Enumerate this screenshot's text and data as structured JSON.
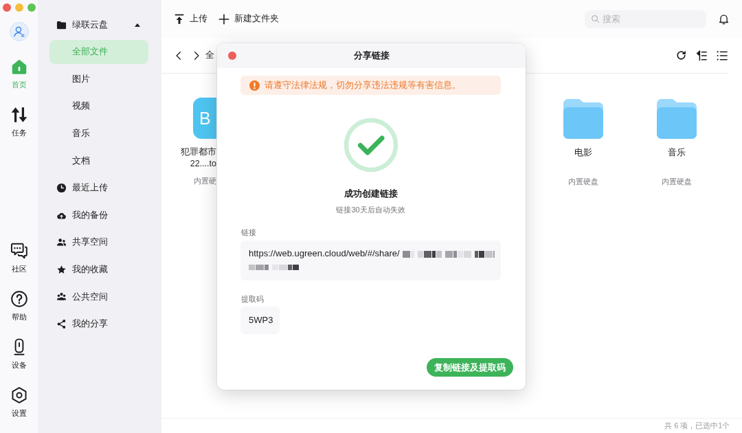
{
  "rail": {
    "top": [
      {
        "label": "首页",
        "selected": true
      },
      {
        "label": "任务",
        "selected": false
      }
    ],
    "bottom": [
      {
        "label": "社区",
        "selected": false
      },
      {
        "label": "帮助",
        "selected": false
      },
      {
        "label": "设备",
        "selected": false
      },
      {
        "label": "设置",
        "selected": false
      }
    ]
  },
  "sidebar": {
    "items": [
      {
        "label": "绿联云盘",
        "selected": false,
        "expanded": true,
        "children": [
          {
            "label": "全部文件",
            "selected": true
          },
          {
            "label": "图片",
            "selected": false
          },
          {
            "label": "视频",
            "selected": false
          },
          {
            "label": "音乐",
            "selected": false
          },
          {
            "label": "文档",
            "selected": false
          }
        ]
      },
      {
        "label": "最近上传",
        "selected": false
      },
      {
        "label": "我的备份",
        "selected": false
      },
      {
        "label": "共享空间",
        "selected": false
      },
      {
        "label": "我的收藏",
        "selected": false
      },
      {
        "label": "公共空间",
        "selected": false
      },
      {
        "label": "我的分享",
        "selected": false
      }
    ]
  },
  "toolbar": {
    "actions": [
      "上传",
      "新建文件夹"
    ],
    "search": {
      "placeholder": "搜索"
    }
  },
  "breadcrumb": [
    "全"
  ],
  "files": [
    {
      "kind": "bt",
      "type_label": "B",
      "name_lines": [
        "犯罪都市",
        "22....to"
      ],
      "location": "内置硬"
    },
    {
      "kind": "folder",
      "name_lines": [
        "电影"
      ],
      "location": "内置硬盘"
    },
    {
      "kind": "folder",
      "name_lines": [
        "音乐"
      ],
      "location": "内置硬盘"
    }
  ],
  "status_bar": "共 6 项，已选中1个",
  "dialog": {
    "title": "分享链接",
    "warning": "请遵守法律法规，切勿分享违法违规等有害信息。",
    "result_title": "成功创建链接",
    "result_note": "链接30天后自动失效",
    "fields": [
      {
        "kind": "link",
        "label": "链接",
        "value": "https://web.ugreen.cloud/web/#/share/",
        "redacted": true
      },
      {
        "kind": "code",
        "label": "提取码",
        "value": "5WP3"
      }
    ],
    "button": "复制链接及提取码"
  }
}
